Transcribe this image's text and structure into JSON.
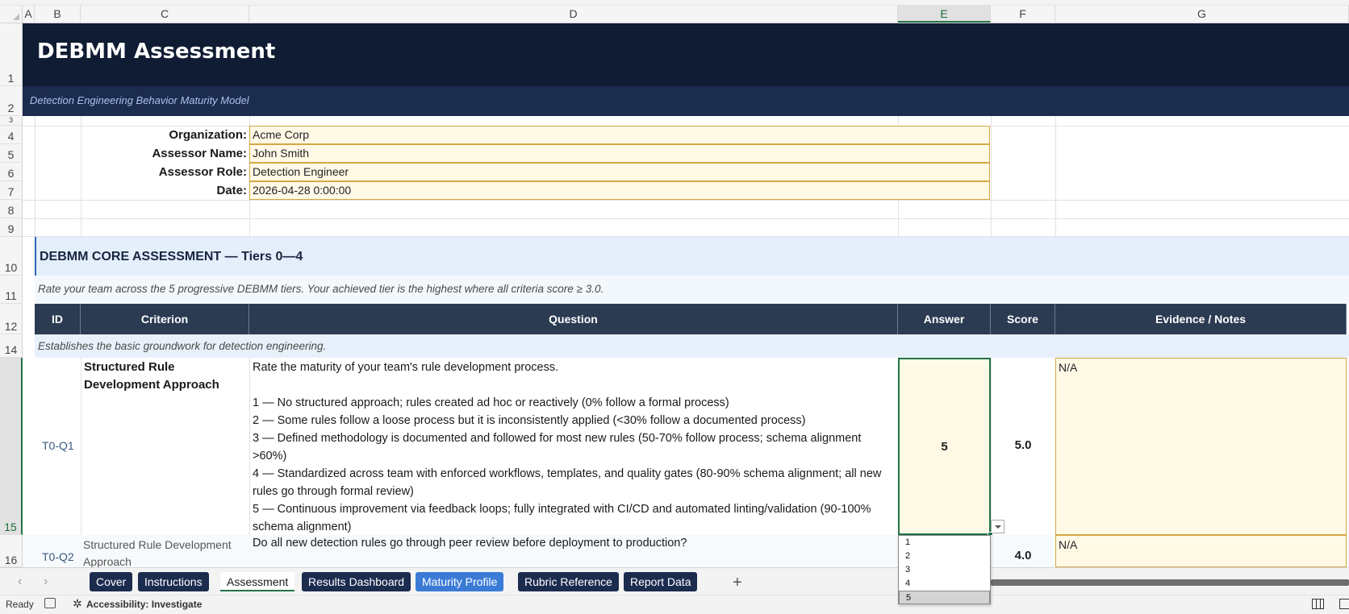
{
  "columns": [
    "A",
    "B",
    "C",
    "D",
    "E",
    "F",
    "G"
  ],
  "rows": [
    "1",
    "2",
    "3",
    "4",
    "5",
    "6",
    "7",
    "8",
    "9",
    "10",
    "11",
    "12",
    "14",
    "15",
    "16"
  ],
  "banner": {
    "title": "DEBMM Assessment",
    "subtitle": "Detection Engineering Behavior Maturity Model"
  },
  "info": {
    "organization_label": "Organization:",
    "organization_value": "Acme Corp",
    "assessor_name_label": "Assessor Name:",
    "assessor_name_value": "John Smith",
    "assessor_role_label": "Assessor Role:",
    "assessor_role_value": "Detection Engineer",
    "date_label": "Date:",
    "date_value": "2026-04-28 0:00:00"
  },
  "section": {
    "title": "DEBMM CORE ASSESSMENT — Tiers 0—4",
    "note": "Rate your team across the 5 progressive DEBMM tiers. Your achieved tier is the highest where all criteria score ≥ 3.0."
  },
  "table_headers": {
    "id": "ID",
    "criterion": "Criterion",
    "question": "Question",
    "answer": "Answer",
    "score": "Score",
    "evidence": "Evidence / Notes"
  },
  "tier_note": "Establishes the basic groundwork for detection engineering.",
  "rows_data": [
    {
      "id": "T0-Q1",
      "criterion": "Structured Rule Development Approach",
      "question_lines": [
        "Rate the maturity of your team's rule development process.",
        "",
        "1 — No structured approach; rules created ad hoc or reactively (0% follow a formal process)",
        "2 — Some rules follow a loose process but it is inconsistently applied (<30% follow a documented process)",
        "3 — Defined methodology is documented and followed for most new rules (50-70% follow process; schema alignment >60%)",
        "4 — Standardized across team with enforced workflows, templates, and quality gates (80-90% schema alignment; all new rules go through formal review)",
        "5 — Continuous improvement via feedback loops; fully integrated with CI/CD and automated linting/validation (90-100% schema alignment)"
      ],
      "answer": "5",
      "score": "5.0",
      "evidence": "N/A"
    },
    {
      "id": "T0-Q2",
      "criterion": "Structured Rule Development Approach",
      "question": "Do all new detection rules go through peer review before deployment to production?",
      "score": "4.0",
      "evidence": "N/A"
    }
  ],
  "dropdown": {
    "options": [
      "1",
      "2",
      "3",
      "4",
      "5"
    ],
    "selected": "5"
  },
  "sheet_tabs": {
    "cover": "Cover",
    "instructions": "Instructions",
    "assessment": "Assessment",
    "results_dashboard": "Results Dashboard",
    "maturity_profile": "Maturity Profile",
    "rubric_reference": "Rubric Reference",
    "report_data": "Report Data",
    "add": "+"
  },
  "status": {
    "ready": "Ready",
    "accessibility": "Accessibility: Investigate"
  },
  "colors": {
    "banner_dark": "#0f1c33",
    "banner_sub": "#1c2c4f",
    "header_bg": "#2a3b52",
    "input_fill": "#fff9e6",
    "input_border": "#d4a843",
    "selection_green": "#217346",
    "tab_blue": "#3b7bd6"
  }
}
